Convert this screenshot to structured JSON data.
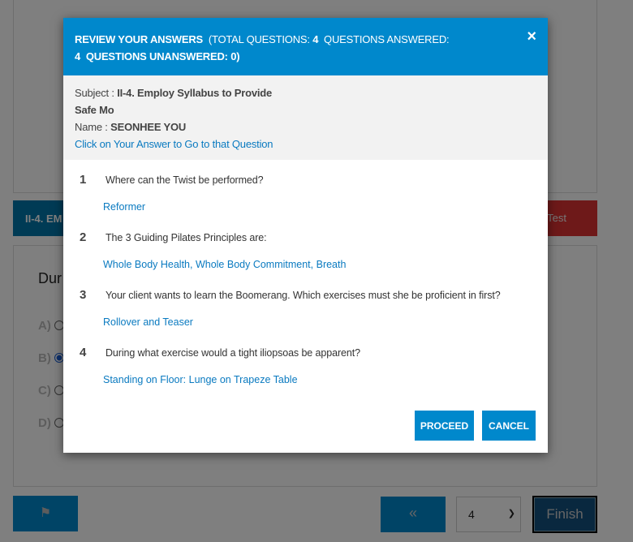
{
  "background": {
    "subject_tab": "II-4. EM",
    "test_button": "Test",
    "question_fragment": "Dur",
    "options": [
      {
        "label": "A)",
        "selected": false
      },
      {
        "label": "B)",
        "selected": true
      },
      {
        "label": "C)",
        "selected": false
      },
      {
        "label": "D)",
        "selected": false
      }
    ],
    "flag_icon": "flag-icon",
    "prev_label": "«",
    "page_select_value": "4",
    "finish_label": "Finish"
  },
  "modal": {
    "title": "REVIEW YOUR ANSWERS",
    "total_label": "(TOTAL QUESTIONS:",
    "total_value": "4",
    "answered_label": "QUESTIONS ANSWERED:",
    "answered_value": "4",
    "unanswered_label": "QUESTIONS UNANSWERED: 0)",
    "close_icon": "×",
    "subject_label": "Subject :",
    "subject_value": "II-4. Employ Syllabus to Provide Safe Mo",
    "name_label": "Name :",
    "name_value": "SEONHEE YOU",
    "hint": "Click on Your Answer to Go to that Question",
    "questions": [
      {
        "num": "1",
        "text": "Where can the Twist be performed?",
        "answer": "Reformer"
      },
      {
        "num": "2",
        "text": "The 3 Guiding Pilates Principles are:",
        "answer": "Whole Body Health, Whole Body Commitment, Breath"
      },
      {
        "num": "3",
        "text": "Your client wants to learn the Boomerang. Which exercises must she be proficient in first?",
        "answer": "Rollover and Teaser"
      },
      {
        "num": "4",
        "text": "During what exercise would a tight iliopsoas be apparent?",
        "answer": "Standing on Floor: Lunge on Trapeze Table"
      }
    ],
    "proceed_label": "PROCEED",
    "cancel_label": "CANCEL"
  },
  "colors": {
    "primary": "#0088cc",
    "danger": "#dd3333",
    "link": "#0a7ac0"
  }
}
